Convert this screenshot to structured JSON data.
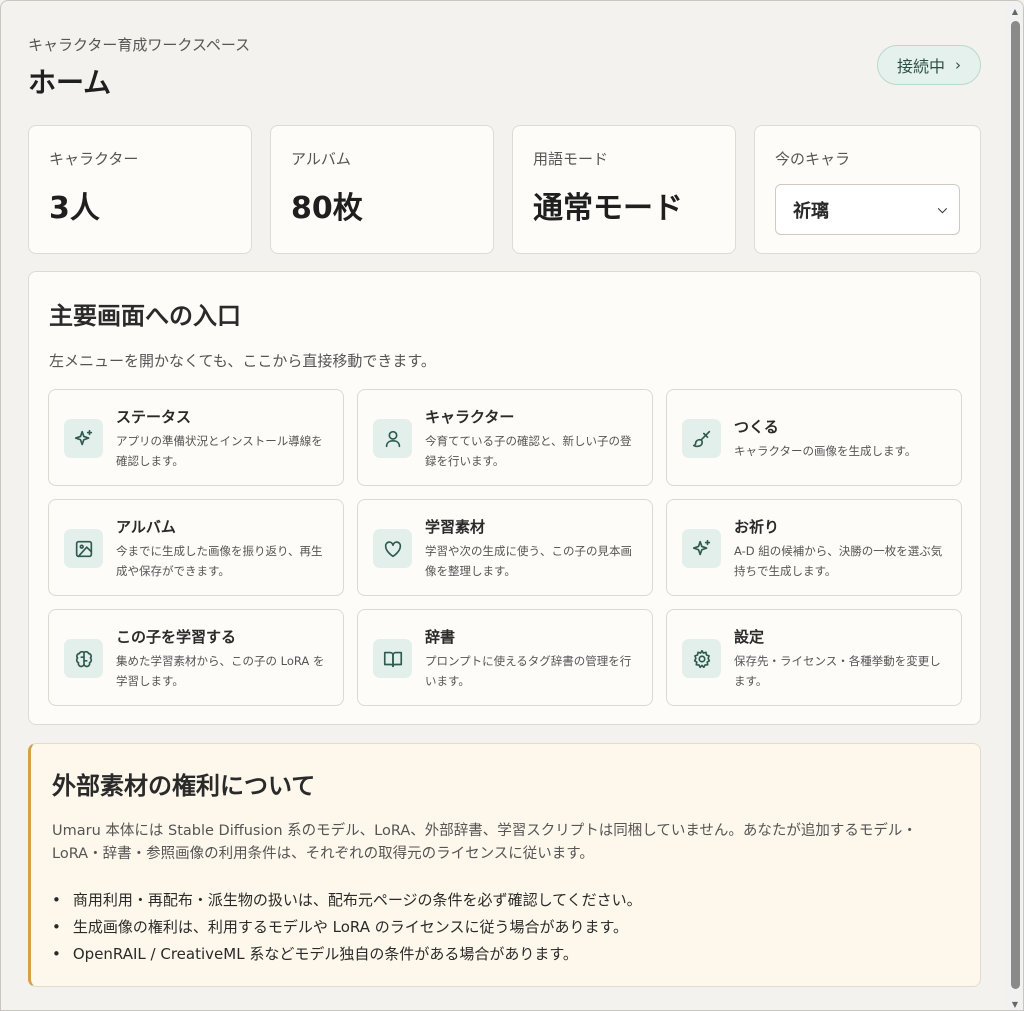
{
  "header": {
    "workspace_label": "キャラクター育成ワークスペース",
    "title": "ホーム",
    "status": "接続中"
  },
  "stats": [
    {
      "label": "キャラクター",
      "value": "3人"
    },
    {
      "label": "アルバム",
      "value": "80枚"
    },
    {
      "label": "用語モード",
      "value": "通常モード"
    },
    {
      "label": "今のキャラ",
      "selected": "祈璃"
    }
  ],
  "entry": {
    "title": "主要画面への入口",
    "description": "左メニューを開かなくても、ここから直接移動できます。",
    "tiles": [
      {
        "title": "ステータス",
        "desc": "アプリの準備状況とインストール導線を確認します。",
        "icon": "sparkles-icon"
      },
      {
        "title": "キャラクター",
        "desc": "今育てている子の確認と、新しい子の登録を行います。",
        "icon": "user-icon"
      },
      {
        "title": "つくる",
        "desc": "キャラクターの画像を生成します。",
        "icon": "brush-icon"
      },
      {
        "title": "アルバム",
        "desc": "今までに生成した画像を振り返り、再生成や保存ができます。",
        "icon": "image-icon"
      },
      {
        "title": "学習素材",
        "desc": "学習や次の生成に使う、この子の見本画像を整理します。",
        "icon": "heart-icon"
      },
      {
        "title": "お祈り",
        "desc": "A-D 組の候補から、決勝の一枚を選ぶ気持ちで生成します。",
        "icon": "sparkles-icon"
      },
      {
        "title": "この子を学習する",
        "desc": "集めた学習素材から、この子の LoRA を学習します。",
        "icon": "brain-icon"
      },
      {
        "title": "辞書",
        "desc": "プロンプトに使えるタグ辞書の管理を行います。",
        "icon": "book-icon"
      },
      {
        "title": "設定",
        "desc": "保存先・ライセンス・各種挙動を変更します。",
        "icon": "gear-icon"
      }
    ]
  },
  "rights": {
    "title": "外部素材の権利について",
    "body": "Umaru 本体には Stable Diffusion 系のモデル、LoRA、外部辞書、学習スクリプトは同梱していません。あなたが追加するモデル・LoRA・辞書・参照画像の利用条件は、それぞれの取得元のライセンスに従います。",
    "items": [
      "商用利用・再配布・派生物の扱いは、配布元ページの条件を必ず確認してください。",
      "生成画像の権利は、利用するモデルや LoRA のライセンスに従う場合があります。",
      "OpenRAIL / CreativeML 系などモデル独自の条件がある場合があります。"
    ]
  },
  "colors": {
    "accent": "#2f5a4f",
    "accent_bg": "#e3efea",
    "warning_border": "#d4a14a"
  }
}
